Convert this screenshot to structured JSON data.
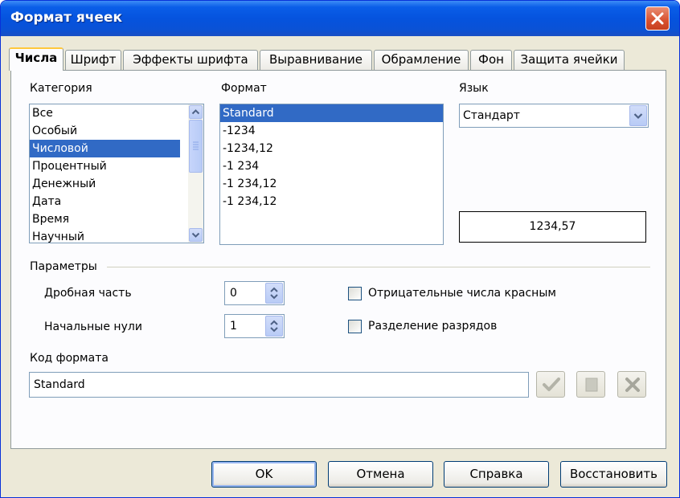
{
  "window": {
    "title": "Формат ячеек"
  },
  "tabs": [
    {
      "label": "Числа"
    },
    {
      "label": "Шрифт"
    },
    {
      "label": "Эффекты шрифта"
    },
    {
      "label": "Выравнивание"
    },
    {
      "label": "Обрамление"
    },
    {
      "label": "Фон"
    },
    {
      "label": "Защита ячейки"
    }
  ],
  "category": {
    "label": "Категория",
    "items": [
      "Все",
      "Особый",
      "Числовой",
      "Процентный",
      "Денежный",
      "Дата",
      "Время",
      "Научный"
    ],
    "selected": "Числовой"
  },
  "format": {
    "label": "Формат",
    "items": [
      "Standard",
      "-1234",
      "-1234,12",
      "-1 234",
      "-1 234,12",
      "-1 234,12"
    ],
    "selected": "Standard"
  },
  "language": {
    "label": "Язык",
    "value": "Стандарт"
  },
  "preview": {
    "value": "1234,57"
  },
  "parameters": {
    "label": "Параметры",
    "decimal_label": "Дробная часть",
    "decimal_value": "0",
    "leading_zeros_label": "Начальные нули",
    "leading_zeros_value": "1",
    "negative_red_label": "Отрицательные числа красным",
    "negative_red_checked": false,
    "thousands_sep_label": "Разделение разрядов",
    "thousands_sep_checked": false
  },
  "format_code": {
    "label": "Код формата",
    "value": "Standard"
  },
  "buttons": {
    "ok": "OK",
    "cancel": "Отмена",
    "help": "Справка",
    "reset": "Восстановить"
  },
  "colors": {
    "titlebar": "#0553de",
    "selection": "#316ac5",
    "dialog_bg": "#ece9d8",
    "close": "#d8502f"
  }
}
